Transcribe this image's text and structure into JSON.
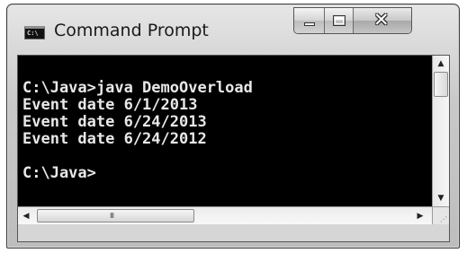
{
  "window": {
    "title": "Command Prompt",
    "icon_label": "C:\\",
    "app_icon": "console-icon",
    "buttons": {
      "minimize": "minimize-icon",
      "maximize": "maximize-icon",
      "close": "close-icon"
    }
  },
  "console": {
    "lines": [
      "C:\\Java>java DemoOverload",
      "Event date 6/1/2013",
      "Event date 6/24/2013",
      "Event date 6/24/2012",
      "",
      "C:\\Java>"
    ],
    "background": "#000000",
    "text_color": "#e8e8e8"
  },
  "scrollbars": {
    "up": "▲",
    "down": "▼",
    "left": "◀",
    "right": "▶",
    "grip": "III"
  }
}
